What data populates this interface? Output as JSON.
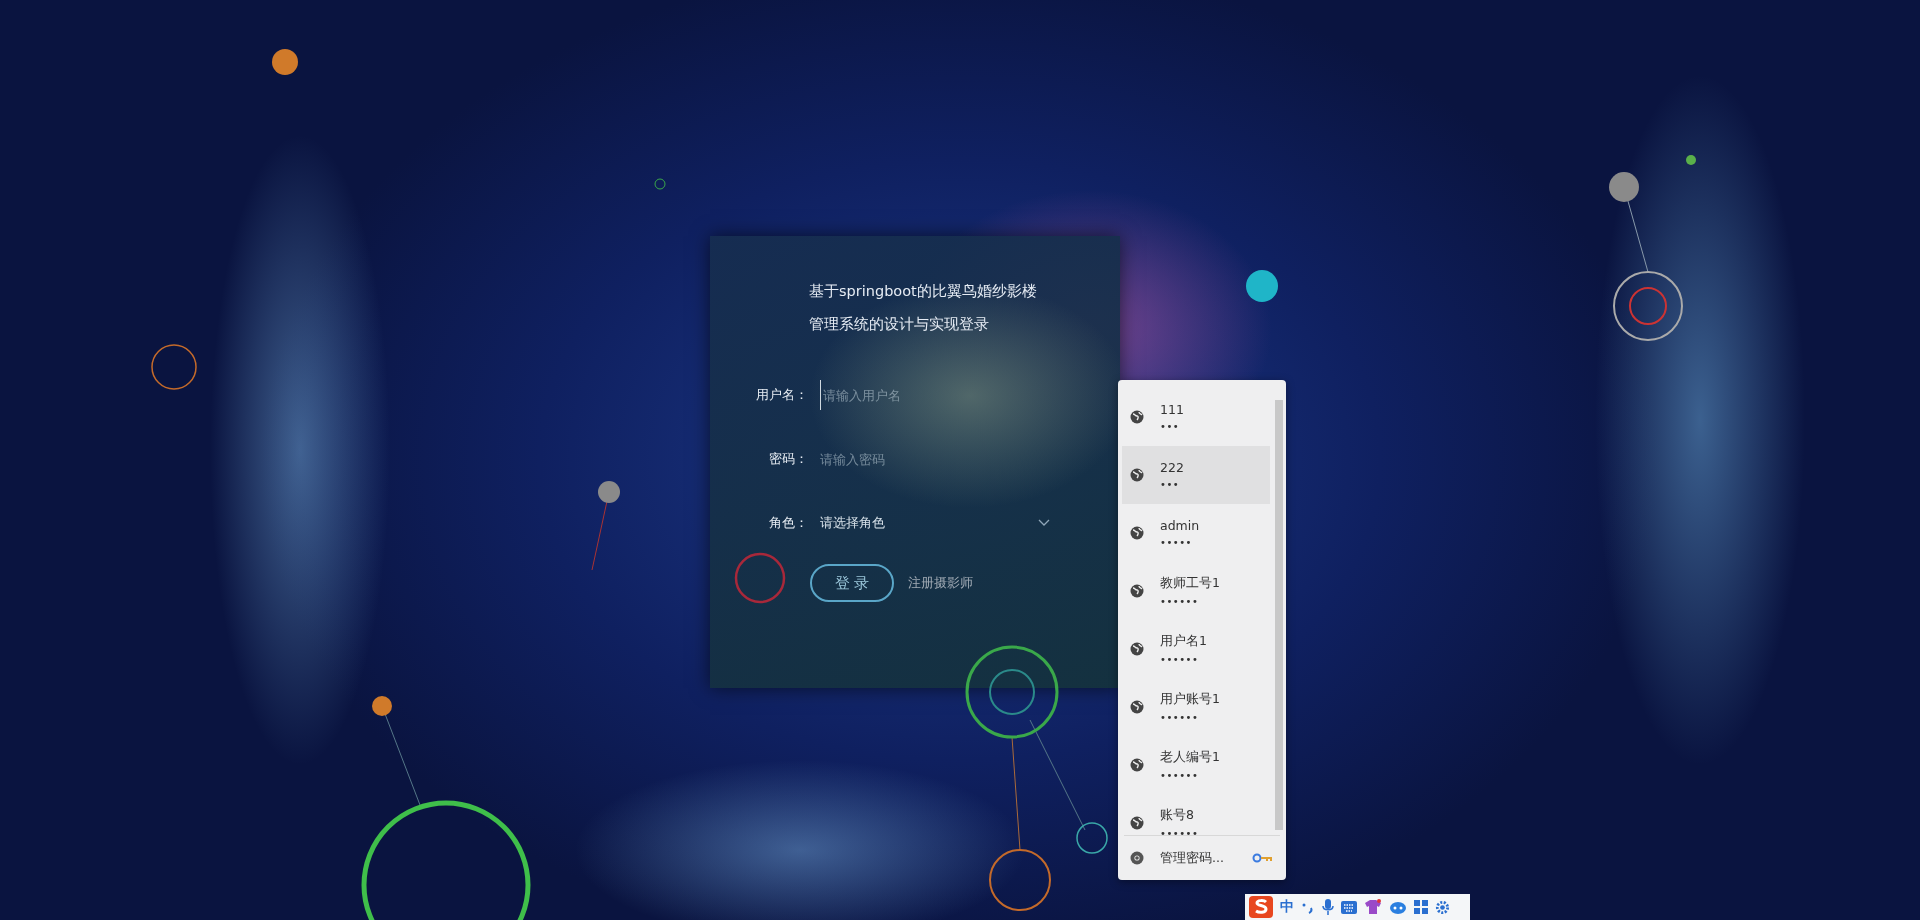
{
  "login": {
    "title_lines": [
      "基于springboot的比翼鸟婚纱影楼",
      "管理系统的设计与实现登录"
    ],
    "fields": [
      {
        "kind": "input",
        "label": "用户名：",
        "placeholder": "请输入用户名"
      },
      {
        "kind": "input",
        "label": "密码：",
        "placeholder": "请输入密码"
      },
      {
        "kind": "select",
        "label": "角色：",
        "placeholder": "请选择角色"
      }
    ],
    "login_button": "登 录",
    "register_link": "注册摄影师"
  },
  "autofill": {
    "items": [
      {
        "username": "111",
        "password": "•••",
        "selected": false
      },
      {
        "username": "222",
        "password": "•••",
        "selected": true
      },
      {
        "username": "admin",
        "password": "•••••",
        "selected": false
      },
      {
        "username": "教师工号1",
        "password": "••••••",
        "selected": false
      },
      {
        "username": "用户名1",
        "password": "••••••",
        "selected": false
      },
      {
        "username": "用户账号1",
        "password": "••••••",
        "selected": false
      },
      {
        "username": "老人编号1",
        "password": "••••••",
        "selected": false
      },
      {
        "username": "账号8",
        "password": "••••••",
        "selected": false
      }
    ],
    "footer": "管理密码..."
  },
  "ime_toolbar": {
    "mode": "中"
  }
}
